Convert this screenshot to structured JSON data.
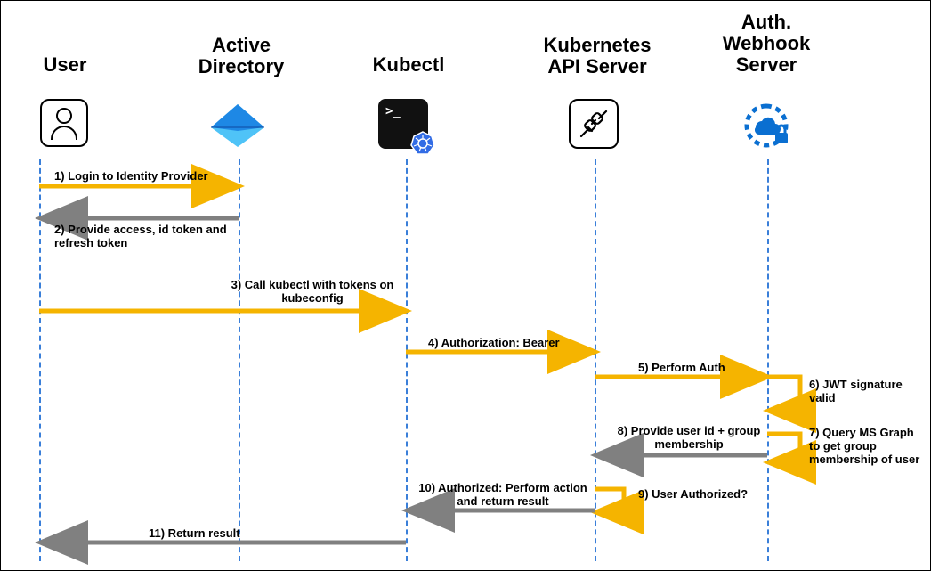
{
  "actors": {
    "user": {
      "title": "User",
      "icon_name": "user-icon"
    },
    "ad": {
      "title": "Active Directory",
      "icon_name": "azure-ad-icon"
    },
    "kubectl": {
      "title": "Kubectl",
      "icon_name": "terminal-kubernetes-icon"
    },
    "api": {
      "title": "Kubernetes API Server",
      "icon_name": "api-plug-icon"
    },
    "webhook": {
      "title": "Auth. Webhook Server",
      "icon_name": "cloud-lock-icon"
    }
  },
  "messages": {
    "m1": "1) Login to Identity Provider",
    "m2": "2) Provide access, id token and refresh token",
    "m3": "3) Call kubectl with tokens on kubeconfig",
    "m4": "4) Authorization: Bearer",
    "m5": "5) Perform Auth",
    "m6": "6) JWT signature valid",
    "m7": "7) Query MS Graph to get group membership of user",
    "m8": "8) Provide user id + group membership",
    "m9": "9) User Authorized?",
    "m10": "10) Authorized: Perform action and return result",
    "m11": "11) Return result"
  },
  "colors": {
    "arrow_forward": "#f5b400",
    "arrow_return": "#808080",
    "lifeline": "#3a7fd9",
    "webhook_blue": "#0a6fd1"
  },
  "chart_data": {
    "type": "sequence-diagram",
    "lifelines": [
      "User",
      "Active Directory",
      "Kubectl",
      "Kubernetes API Server",
      "Auth. Webhook Server"
    ],
    "messages": [
      {
        "from": "User",
        "to": "Active Directory",
        "label": "1) Login to Identity Provider",
        "direction": "request"
      },
      {
        "from": "Active Directory",
        "to": "User",
        "label": "2) Provide access, id token and refresh token",
        "direction": "response"
      },
      {
        "from": "User",
        "to": "Kubectl",
        "label": "3) Call kubectl with tokens on kubeconfig",
        "direction": "request"
      },
      {
        "from": "Kubectl",
        "to": "Kubernetes API Server",
        "label": "4) Authorization: Bearer",
        "direction": "request"
      },
      {
        "from": "Kubernetes API Server",
        "to": "Auth. Webhook Server",
        "label": "5) Perform Auth",
        "direction": "request"
      },
      {
        "from": "Auth. Webhook Server",
        "to": "Auth. Webhook Server",
        "label": "6) JWT signature valid",
        "direction": "self"
      },
      {
        "from": "Auth. Webhook Server",
        "to": "Auth. Webhook Server",
        "label": "7) Query MS Graph to get group membership of user",
        "direction": "self"
      },
      {
        "from": "Auth. Webhook Server",
        "to": "Kubernetes API Server",
        "label": "8) Provide user id + group membership",
        "direction": "response"
      },
      {
        "from": "Auth. Webhook Server",
        "to": "Kubernetes API Server",
        "label": "9) User Authorized?",
        "direction": "self-question"
      },
      {
        "from": "Kubernetes API Server",
        "to": "Kubectl",
        "label": "10) Authorized: Perform action and return result",
        "direction": "response"
      },
      {
        "from": "Kubectl",
        "to": "User",
        "label": "11) Return result",
        "direction": "response"
      }
    ]
  }
}
